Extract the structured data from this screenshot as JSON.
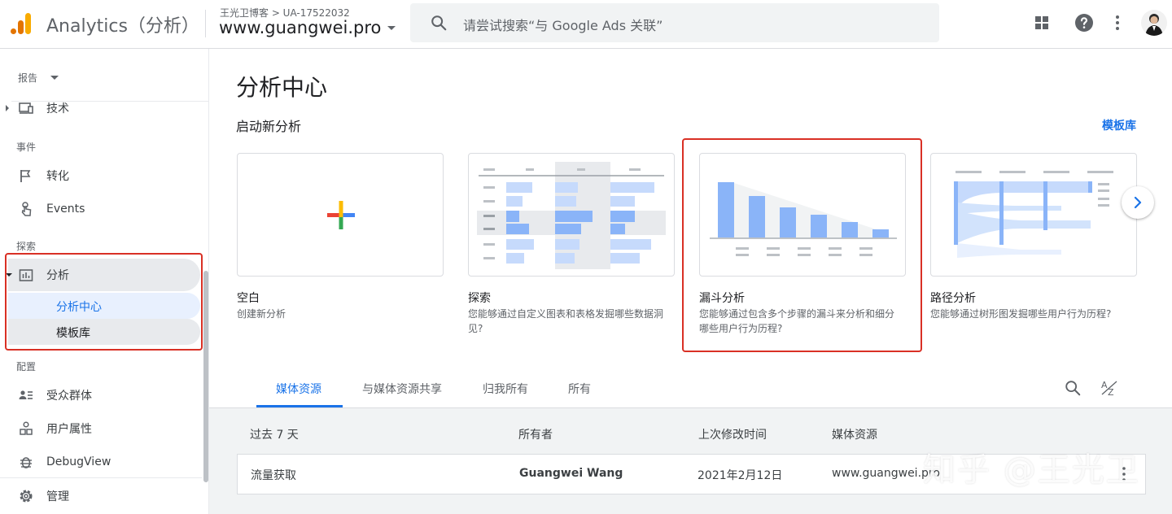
{
  "header": {
    "app_title": "Analytics（分析）",
    "breadcrumb": "王光卫博客 > UA-17522032",
    "property_name": "www.guangwei.pro",
    "search_placeholder": "请尝试搜索“与 Google Ads 关联”"
  },
  "sidebar": {
    "report_label": "报告",
    "items": {
      "tech": "技术",
      "conversion": "转化",
      "events": "Events",
      "analysis": "分析",
      "analysis_hub": "分析中心",
      "template_gallery": "模板库",
      "audiences": "受众群体",
      "user_properties": "用户属性",
      "debugview": "DebugView",
      "admin": "管理"
    },
    "sections": {
      "events": "事件",
      "explore": "探索",
      "configure": "配置"
    }
  },
  "main": {
    "title": "分析中心",
    "start_new": "启动新分析",
    "template_link": "模板库",
    "cards": [
      {
        "name": "空白",
        "desc": "创建新分析"
      },
      {
        "name": "探索",
        "desc": "您能够通过自定义图表和表格发掘哪些数据洞见?"
      },
      {
        "name": "漏斗分析",
        "desc": "您能够通过包含多个步骤的漏斗来分析和细分哪些用户行为历程?"
      },
      {
        "name": "路径分析",
        "desc": "您能够通过树形图发掘哪些用户行为历程?"
      }
    ],
    "tabs": [
      "媒体资源",
      "与媒体资源共享",
      "归我所有",
      "所有"
    ],
    "table": {
      "headers": [
        "过去 7 天",
        "所有者",
        "上次修改时间",
        "媒体资源"
      ],
      "rows": [
        {
          "name": "流量获取",
          "owner": "Guangwei Wang",
          "modified": "2021年2月12日",
          "property": "www.guangwei.pro"
        }
      ]
    }
  },
  "watermark": "知乎 @王光卫",
  "colors": {
    "accent": "#1a73e8",
    "highlight_box": "#d93025",
    "chart_bar": "#8ab4f8"
  }
}
